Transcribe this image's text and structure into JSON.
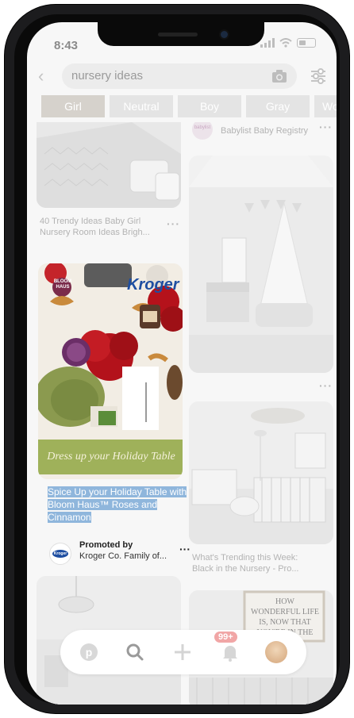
{
  "status": {
    "time": "8:43"
  },
  "search": {
    "query": "nursery ideas"
  },
  "chips": [
    "Girl",
    "Neutral",
    "Boy",
    "Gray",
    "Woo"
  ],
  "left_column": {
    "pin1": {
      "caption": "40 Trendy Ideas Baby Girl Nursery Room Ideas Brigh..."
    },
    "promo": {
      "brand_logo_text": "Kroger",
      "bloom_badge_text": "BLOOM HAUS",
      "banner_text": "Dress up your Holiday Table",
      "title": "Spice Up your Holiday Table with Bloom Haus™ Roses and Cinnamon",
      "promoted_by_label": "Promoted by",
      "advertiser": "Kroger Co. Family of...",
      "advertiser_logo_text": "Kroger"
    }
  },
  "right_column": {
    "top_pin": {
      "avatar_text": "babylist",
      "source": "Babylist Baby Registry"
    },
    "pin2": {
      "caption": "What's Trending this Week: Black in the Nursery - Pro..."
    },
    "pin3": {
      "wall_sign": "HOW WONDERFUL LIFE IS, NOW THAT YOU'RE IN THE"
    }
  },
  "navbar": {
    "badge": "99+"
  },
  "colors": {
    "highlight": "#8fb6dc",
    "badge": "#f1a6a6",
    "kroger_blue": "#1e4ea1"
  }
}
